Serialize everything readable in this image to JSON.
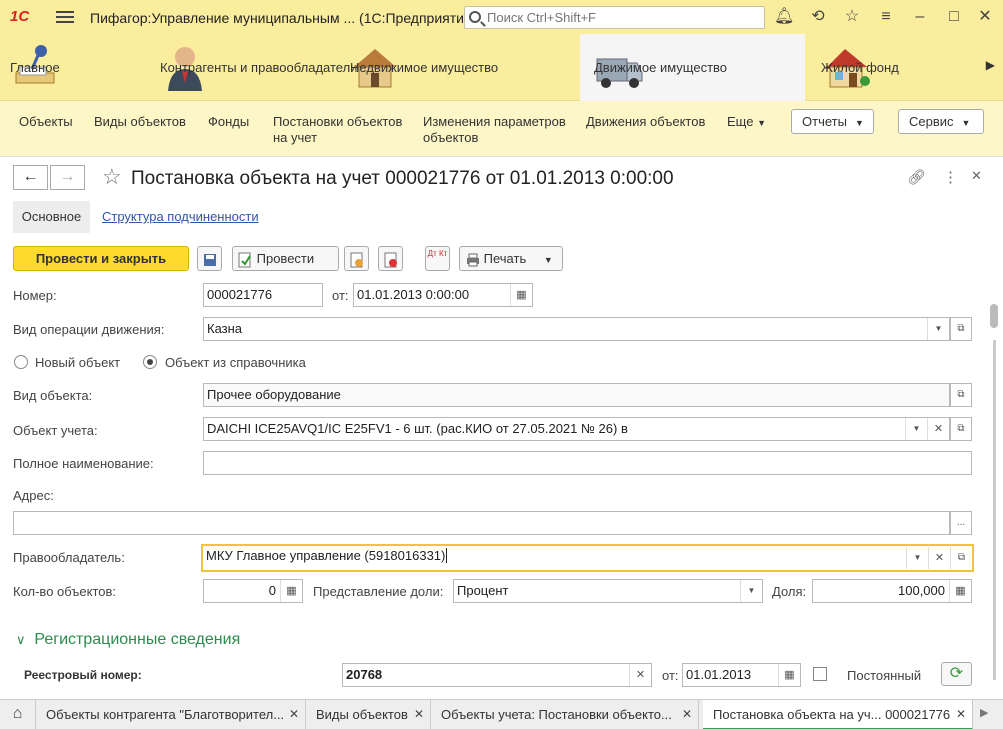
{
  "app": {
    "logo": "1С",
    "title": "Пифагор:Управление муниципальным ...   (1С:Предприятие)",
    "search_placeholder": "Поиск Ctrl+Shift+F"
  },
  "sections": [
    {
      "label": "Главное",
      "icon": "desk-lamp-icon"
    },
    {
      "label": "Контрагенты и правообладатели",
      "icon": "person-icon"
    },
    {
      "label": "Недвижимое имущество",
      "icon": "house-icon"
    },
    {
      "label": "Движимое имущество",
      "icon": "van-icon",
      "active": true
    },
    {
      "label": "Жилой фонд",
      "icon": "residential-house-icon"
    }
  ],
  "functions": {
    "items": [
      "Объекты",
      "Виды объектов",
      "Фонды",
      "Постановки объектов на учет",
      "Изменения параметров объектов",
      "Движения объектов",
      "Еще"
    ],
    "reports": "Отчеты",
    "service": "Сервис"
  },
  "form": {
    "title": "Постановка объекта на учет 000021776 от 01.01.2013 0:00:00",
    "tab_main": "Основное",
    "tab_structure": "Структура подчиненности",
    "btn_post_close": "Провести и закрыть",
    "btn_post": "Провести",
    "btn_print": "Печать",
    "dtkt": "Дт Кт",
    "number_label": "Номер:",
    "number": "000021776",
    "date_label": "от:",
    "date": "01.01.2013  0:00:00",
    "operation_label": "Вид операции движения:",
    "operation": "Казна",
    "radio_new": "Новый объект",
    "radio_catalog": "Объект из справочника",
    "object_type_label": "Вид объекта:",
    "object_type": "Прочее  оборудование",
    "object_label": "Объект учета:",
    "object": "DAICHI ICE25AVQ1/IC E25FV1 - 6 шт.  (рас.КИО от 27.05.2021 № 26)  в",
    "fullname_label": "Полное наименование:",
    "fullname": "",
    "address_label": "Адрес:",
    "address": "",
    "address_btn": "...",
    "owner_label": "Правообладатель:",
    "owner": "МКУ Главное управление (5918016331)",
    "count_label": "Кол-во объектов:",
    "count": "0",
    "share_repr_label": "Представление доли:",
    "share_repr": "Процент",
    "share_label": "Доля:",
    "share": "100,000",
    "reg_group": "Регистрационные сведения",
    "reg_number_label": "Реестровый номер:",
    "reg_number": "20768",
    "reg_date_label": "от:",
    "reg_date": "01.01.2013",
    "permanent_label": "Постоянный"
  },
  "windows": [
    {
      "label": "Объекты контрагента \"Благотворител..."
    },
    {
      "label": "Виды объектов"
    },
    {
      "label": "Объекты учета: Постановки объекто..."
    },
    {
      "label": "Постановка объекта на уч... 000021776",
      "active": true
    }
  ]
}
